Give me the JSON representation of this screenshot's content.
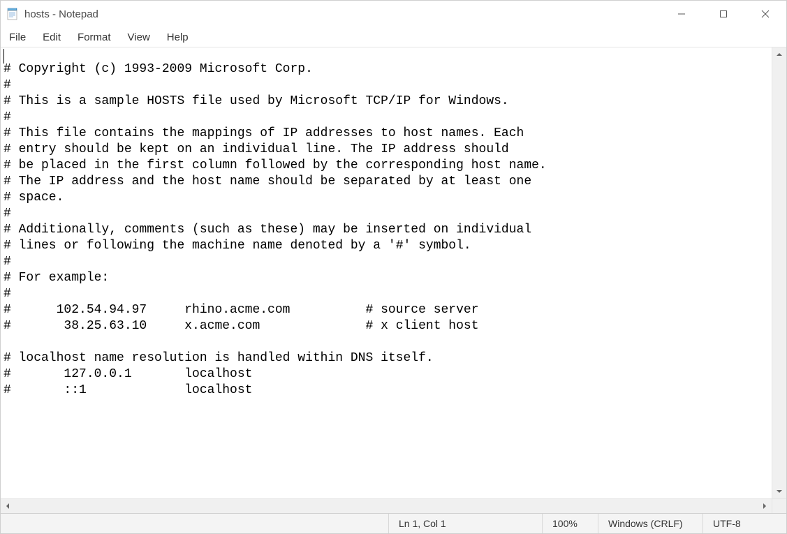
{
  "window": {
    "title": "hosts - Notepad"
  },
  "menu": {
    "items": [
      "File",
      "Edit",
      "Format",
      "View",
      "Help"
    ]
  },
  "editor": {
    "content": "# Copyright (c) 1993-2009 Microsoft Corp.\n#\n# This is a sample HOSTS file used by Microsoft TCP/IP for Windows.\n#\n# This file contains the mappings of IP addresses to host names. Each\n# entry should be kept on an individual line. The IP address should\n# be placed in the first column followed by the corresponding host name.\n# The IP address and the host name should be separated by at least one\n# space.\n#\n# Additionally, comments (such as these) may be inserted on individual\n# lines or following the machine name denoted by a '#' symbol.\n#\n# For example:\n#\n#      102.54.94.97     rhino.acme.com          # source server\n#       38.25.63.10     x.acme.com              # x client host\n\n# localhost name resolution is handled within DNS itself.\n#\t127.0.0.1       localhost\n#\t::1             localhost\n"
  },
  "status": {
    "position": "Ln 1, Col 1",
    "zoom": "100%",
    "eol": "Windows (CRLF)",
    "encoding": "UTF-8"
  },
  "icons": {
    "app": "notepad-icon",
    "minimize": "minimize-icon",
    "maximize": "maximize-icon",
    "close": "close-icon",
    "up": "chevron-up-icon",
    "down": "chevron-down-icon",
    "left": "chevron-left-icon",
    "right": "chevron-right-icon"
  }
}
